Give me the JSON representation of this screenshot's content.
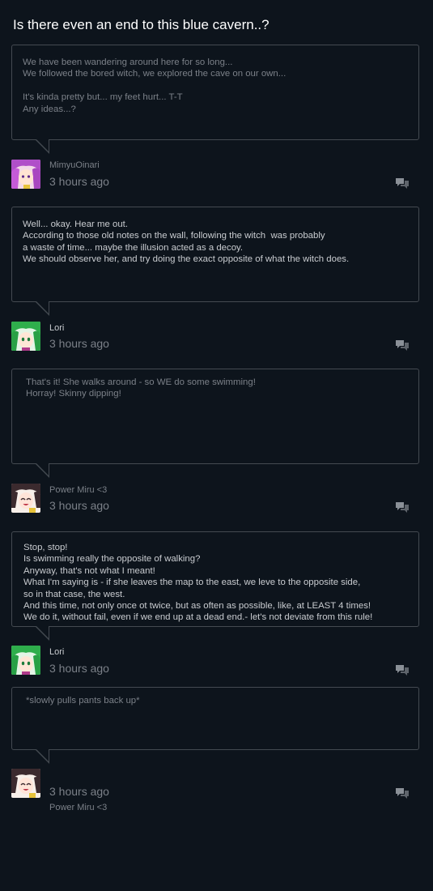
{
  "thread": {
    "title": "Is there even an end to this blue cavern..?"
  },
  "posts": [
    {
      "user": "MimyuOinari",
      "time": "3 hours ago",
      "avatar": "pink-haired-girl-avatar",
      "lines": [
        "We have been wandering around here for so long...",
        "We followed the bored witch, we explored the cave on our own...",
        "",
        "It's kinda pretty but... my feet hurt... T-T",
        "Any ideas...?"
      ]
    },
    {
      "user": "Lori",
      "time": "3 hours ago",
      "avatar": "green-haired-girl-avatar",
      "lines": [
        "Well... okay. Hear me out.",
        "According to those old notes on the wall, following the witch  was probably",
        "a waste of time... maybe the illusion acted as a decoy.",
        "We should observe her, and try doing the exact opposite of what the witch does."
      ]
    },
    {
      "user": "Power Miru <3",
      "time": "3 hours ago",
      "avatar": "dark-haired-girl-avatar",
      "lines": [
        "That's it! She walks around - so WE do some swimming!",
        "Horray! Skinny dipping!"
      ]
    },
    {
      "user": "Lori",
      "time": "3 hours ago",
      "avatar": "green-haired-girl-avatar",
      "lines": [
        "Stop, stop!",
        "Is swimming really the opposite of walking?",
        "Anyway, that's not what I meant!",
        "What I'm saying is - if she leaves the map to the east, we leve to the opposite side,",
        "so in that case, the west.",
        "And this time, not only once ot twice, but as often as possible, like, at LEAST 4 times!",
        "We do it, without fail, even if we end up at a dead end.- let's not deviate from this rule!"
      ]
    },
    {
      "user": "Power Miru <3",
      "time": "3 hours ago",
      "avatar": "dark-haired-girl-avatar",
      "lines": [
        "*slowly pulls pants back up*"
      ]
    }
  ],
  "colors": {
    "background": "#0d141c",
    "bubble_border": "#444a51",
    "bright_text": "#c9ccd0",
    "dim_text": "#7b8088",
    "title": "#ffffff"
  },
  "icons": {
    "reply": "reply-speech-bubbles-icon"
  }
}
